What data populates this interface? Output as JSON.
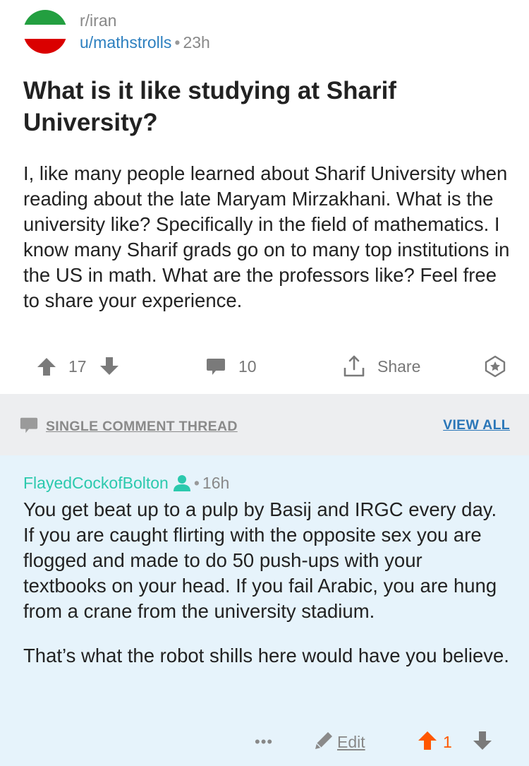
{
  "post": {
    "subreddit": "r/iran",
    "author": "u/mathstrolls",
    "separator": "•",
    "age": "23h",
    "flag_colors": [
      "#239f40",
      "#ffffff",
      "#da0000"
    ],
    "title": "What is it like studying at Sharif University?",
    "body": "I, like many people learned about Sharif University when reading about the late Maryam Mirzakhani. What is the university like? Specifically in the field of mathematics. I know many Sharif grads go on to many top institutions in the US in math. What are the professors like? Feel free to share your experience.",
    "actions": {
      "upvote_icon": "arrow-up-icon",
      "score": "17",
      "downvote_icon": "arrow-down-icon",
      "comment_icon": "speech-bubble-icon",
      "comments": "10",
      "share_icon": "share-upload-icon",
      "share_label": "Share",
      "save_icon": "star-badge-icon"
    }
  },
  "thread_bar": {
    "icon": "speech-bubble-icon",
    "label": "SINGLE COMMENT THREAD",
    "view_all": "VIEW ALL"
  },
  "comment": {
    "author": "FlayedCockofBolton",
    "author_icon": "user-icon",
    "separator": "•",
    "age": "16h",
    "paragraphs": [
      "You get beat up to a pulp by Basij and IRGC every day. If you are caught flirting with the opposite sex you are flogged and made to do 50 push-ups with your textbooks on your head. If you fail Arabic, you are hung from a crane from the university stadium.",
      "That’s what the robot shills here would have you believe."
    ],
    "actions": {
      "more": "•••",
      "edit_icon": "pencil-icon",
      "edit_label": "Edit",
      "upvote_icon": "arrow-up-icon",
      "score": "1",
      "downvote_icon": "arrow-down-icon"
    }
  },
  "colors": {
    "author_link": "#2c7fbf",
    "commenter": "#2bc9ad",
    "upvote_active": "#ff5700",
    "thread_bar_bg": "#edeef0",
    "comment_bg": "#e6f3fb",
    "view_all": "#2a76b8"
  }
}
